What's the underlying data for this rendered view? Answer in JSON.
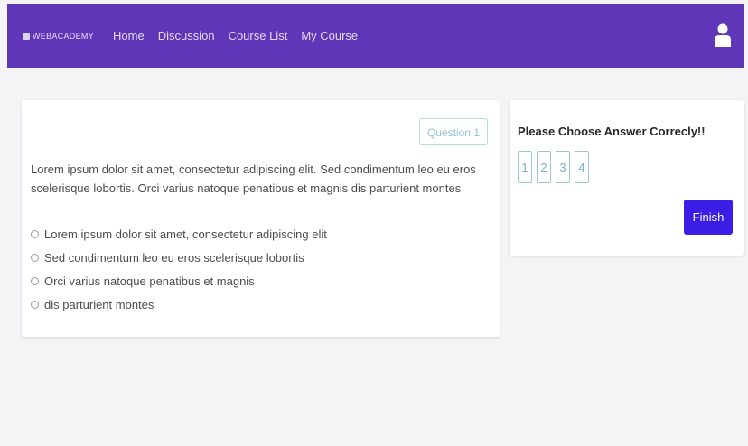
{
  "navbar": {
    "brand": "WEBACADEMY",
    "links": [
      "Home",
      "Discussion",
      "Course List",
      "My Course"
    ],
    "user_icon": "user-icon",
    "background_color": "#6036b8"
  },
  "question_card": {
    "badge": "Question 1",
    "text": "Lorem ipsum dolor sit amet, consectetur adipiscing elit. Sed condimentum leo eu eros scelerisque lobortis. Orci varius natoque penatibus et magnis dis parturient montes",
    "options": [
      "Lorem ipsum dolor sit amet, consectetur adipiscing elit",
      "Sed condimentum leo eu eros scelerisque lobortis",
      "Orci varius natoque penatibus et magnis",
      "dis parturient montes"
    ]
  },
  "answer_card": {
    "title": "Please Choose Answer Correcly!!",
    "numbers": [
      "1",
      "2",
      "3",
      "4"
    ],
    "finish_label": "Finish",
    "finish_color": "#3a1ee6"
  }
}
